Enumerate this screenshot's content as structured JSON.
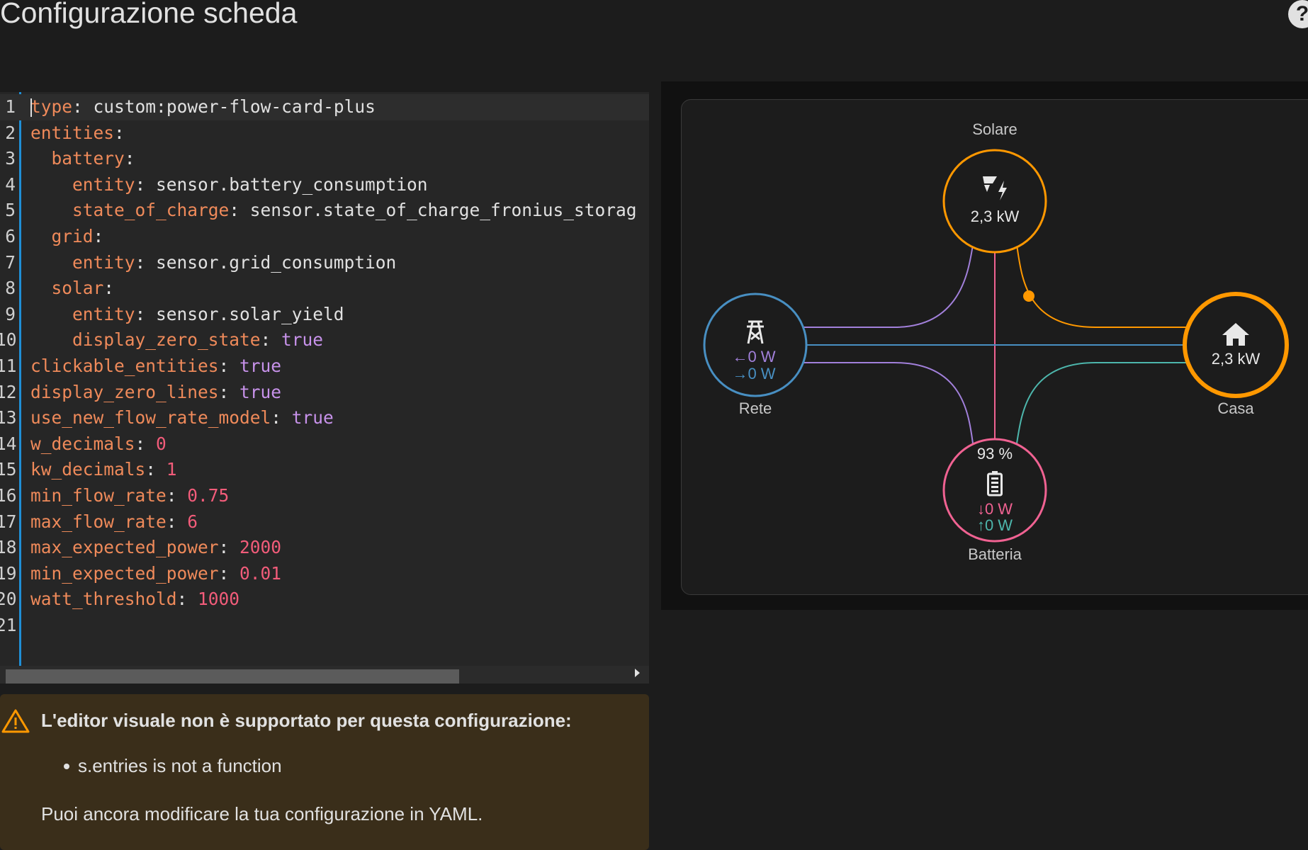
{
  "header": {
    "title": "Configurazione scheda",
    "help_label": "?"
  },
  "editor": {
    "lines": [
      {
        "no": "1",
        "tokens": [
          [
            "k",
            "type"
          ],
          [
            "p",
            ": "
          ],
          [
            "v",
            "custom"
          ],
          [
            "p",
            ":"
          ],
          [
            "v",
            "power-flow-card-plus"
          ]
        ]
      },
      {
        "no": "2",
        "tokens": [
          [
            "k",
            "entities"
          ],
          [
            "p",
            ":"
          ]
        ]
      },
      {
        "no": "3",
        "tokens": [
          [
            "p",
            "  "
          ],
          [
            "k",
            "battery"
          ],
          [
            "p",
            ":"
          ]
        ]
      },
      {
        "no": "4",
        "tokens": [
          [
            "p",
            "    "
          ],
          [
            "k",
            "entity"
          ],
          [
            "p",
            ": "
          ],
          [
            "v",
            "sensor.battery_consumption"
          ]
        ]
      },
      {
        "no": "5",
        "tokens": [
          [
            "p",
            "    "
          ],
          [
            "k",
            "state_of_charge"
          ],
          [
            "p",
            ": "
          ],
          [
            "v",
            "sensor.state_of_charge_fronius_storag"
          ]
        ]
      },
      {
        "no": "6",
        "tokens": [
          [
            "p",
            "  "
          ],
          [
            "k",
            "grid"
          ],
          [
            "p",
            ":"
          ]
        ]
      },
      {
        "no": "7",
        "tokens": [
          [
            "p",
            "    "
          ],
          [
            "k",
            "entity"
          ],
          [
            "p",
            ": "
          ],
          [
            "v",
            "sensor.grid_consumption"
          ]
        ]
      },
      {
        "no": "8",
        "tokens": [
          [
            "p",
            "  "
          ],
          [
            "k",
            "solar"
          ],
          [
            "p",
            ":"
          ]
        ]
      },
      {
        "no": "9",
        "tokens": [
          [
            "p",
            "    "
          ],
          [
            "k",
            "entity"
          ],
          [
            "p",
            ": "
          ],
          [
            "v",
            "sensor.solar_yield"
          ]
        ]
      },
      {
        "no": "10",
        "tokens": [
          [
            "p",
            "    "
          ],
          [
            "k",
            "display_zero_state"
          ],
          [
            "p",
            ": "
          ],
          [
            "b",
            "true"
          ]
        ]
      },
      {
        "no": "11",
        "tokens": [
          [
            "k",
            "clickable_entities"
          ],
          [
            "p",
            ": "
          ],
          [
            "b",
            "true"
          ]
        ]
      },
      {
        "no": "12",
        "tokens": [
          [
            "k",
            "display_zero_lines"
          ],
          [
            "p",
            ": "
          ],
          [
            "b",
            "true"
          ]
        ]
      },
      {
        "no": "13",
        "tokens": [
          [
            "k",
            "use_new_flow_rate_model"
          ],
          [
            "p",
            ": "
          ],
          [
            "b",
            "true"
          ]
        ]
      },
      {
        "no": "14",
        "tokens": [
          [
            "k",
            "w_decimals"
          ],
          [
            "p",
            ": "
          ],
          [
            "n",
            "0"
          ]
        ]
      },
      {
        "no": "15",
        "tokens": [
          [
            "k",
            "kw_decimals"
          ],
          [
            "p",
            ": "
          ],
          [
            "n",
            "1"
          ]
        ]
      },
      {
        "no": "16",
        "tokens": [
          [
            "k",
            "min_flow_rate"
          ],
          [
            "p",
            ": "
          ],
          [
            "n",
            "0.75"
          ]
        ]
      },
      {
        "no": "17",
        "tokens": [
          [
            "k",
            "max_flow_rate"
          ],
          [
            "p",
            ": "
          ],
          [
            "n",
            "6"
          ]
        ]
      },
      {
        "no": "18",
        "tokens": [
          [
            "k",
            "max_expected_power"
          ],
          [
            "p",
            ": "
          ],
          [
            "n",
            "2000"
          ]
        ]
      },
      {
        "no": "19",
        "tokens": [
          [
            "k",
            "min_expected_power"
          ],
          [
            "p",
            ": "
          ],
          [
            "n",
            "0.01"
          ]
        ]
      },
      {
        "no": "20",
        "tokens": [
          [
            "k",
            "watt_threshold"
          ],
          [
            "p",
            ": "
          ],
          [
            "n",
            "1000"
          ]
        ]
      },
      {
        "no": "21",
        "tokens": []
      }
    ]
  },
  "warning": {
    "title": "L'editor visuale non è supportato per questa configurazione:",
    "item": "s.entries is not a function",
    "footer": "Puoi ancora modificare la tua configurazione in YAML."
  },
  "flow": {
    "solar": {
      "label": "Solare",
      "value": "2,3 kW",
      "color": "#ff9800"
    },
    "grid": {
      "label": "Rete",
      "import": "0 W",
      "export": "0 W",
      "color": "#488fc2",
      "import_color": "#a280db"
    },
    "home": {
      "label": "Casa",
      "value": "2,3 kW",
      "color": "#ff9800"
    },
    "battery": {
      "label": "Batteria",
      "soc": "93 %",
      "in": "0 W",
      "out": "0 W",
      "color": "#f06292",
      "out_color": "#4db6ac"
    },
    "line_colors": {
      "solar_grid": "#a280db",
      "solar_battery": "#f06292",
      "grid_home": "#488fc2",
      "battery_home": "#4db6ac",
      "solar_home": "#ff9800"
    }
  }
}
